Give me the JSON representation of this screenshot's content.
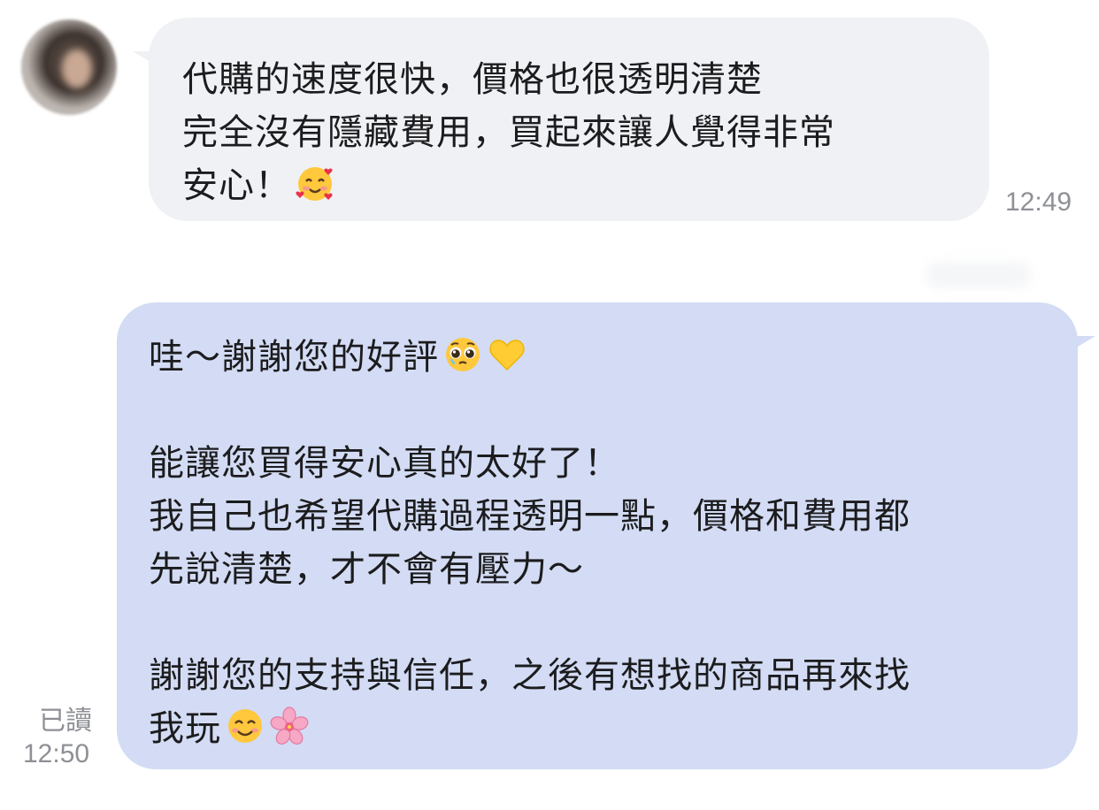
{
  "incoming": {
    "lines": [
      "代購的速度很快，價格也很透明清楚",
      "完全沒有隱藏費用，買起來讓人覺得非常",
      "安心！"
    ],
    "emoji": "smiling-face-with-hearts",
    "time": "12:49"
  },
  "outgoing": {
    "lines": [
      "哇～謝謝您的好評",
      "能讓您買得安心真的太好了！",
      "我自己也希望代購過程透明一點，價格和費用都",
      "先說清楚，才不會有壓力～",
      "謝謝您的支持與信任，之後有想找的商品再來找",
      "我玩"
    ],
    "emojis": [
      "pleading-face",
      "yellow-heart",
      "smiling-face",
      "cherry-blossom"
    ],
    "read_label": "已讀",
    "time": "12:50"
  },
  "colors": {
    "incoming_bubble": "#eff1f4",
    "outgoing_bubble": "#d3dcf4",
    "meta_text": "#8e9095"
  }
}
